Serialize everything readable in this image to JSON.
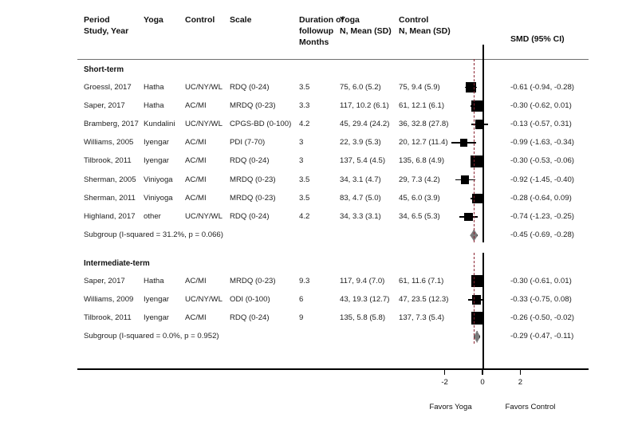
{
  "header": {
    "col_period": "Period\nStudy, Year",
    "col_yoga": "Yoga",
    "col_control": "Control",
    "col_scale": "Scale",
    "col_duration": "Duration of\nfollowup\nMonths",
    "col_yoga_n": "Yoga\nN, Mean (SD)",
    "col_control_n": "Control\nN, Mean (SD)",
    "col_smd": "SMD (95% CI)"
  },
  "axis": {
    "ticks": [
      "-2",
      "0",
      "2"
    ],
    "tick_values": [
      -2,
      0,
      2
    ],
    "favors_left": "Favors Yoga",
    "favors_right": "Favors Control",
    "null_value": 0
  },
  "colors": {
    "marker": "#000000",
    "diamond_fill": "#7b7b7b",
    "diamond_edge": "#2a2a2a",
    "prediction_line": "#8b2230",
    "rule": "#6f6f6f"
  },
  "chart_data": {
    "type": "forest",
    "title": "",
    "xlabel": "SMD (95% CI)",
    "xlim": [
      -2.6,
      2.8
    ],
    "null_line": 0,
    "groups": [
      {
        "label": "Short-term",
        "studies": [
          {
            "study": "Groessl, 2017",
            "yoga": "Hatha",
            "control": "UC/NY/WL",
            "scale": "RDQ (0-24)",
            "duration": "3.5",
            "yoga_n": "75, 6.0 (5.2)",
            "control_n": "75, 9.4 (5.9)",
            "smd_text": "-0.61 (-0.94, -0.28)",
            "smd": -0.61,
            "ci_low": -0.94,
            "ci_high": -0.28,
            "weight": 10.6
          },
          {
            "study": "Saper, 2017",
            "yoga": "Hatha",
            "control": "AC/MI",
            "scale": "MRDQ (0-23)",
            "duration": "3.3",
            "yoga_n": "117, 10.2 (6.1)",
            "control_n": "61, 12.1 (6.1)",
            "smd_text": "-0.30 (-0.62, 0.01)",
            "smd": -0.3,
            "ci_low": -0.62,
            "ci_high": 0.01,
            "weight": 11.5
          },
          {
            "study": "Bramberg, 2017",
            "yoga": "Kundalini",
            "control": "UC/NY/WL",
            "scale": "CPGS-BD (0-100)",
            "duration": "4.2",
            "yoga_n": "45, 29.4 (24.2)",
            "control_n": "36, 32.8 (27.8)",
            "smd_text": "-0.13 (-0.57, 0.31)",
            "smd": -0.13,
            "ci_low": -0.57,
            "ci_high": 0.31,
            "weight": 8.2
          },
          {
            "study": "Williams, 2005",
            "yoga": "Iyengar",
            "control": "AC/MI",
            "scale": "PDI (7-70)",
            "duration": "3",
            "yoga_n": "22, 3.9 (5.3)",
            "control_n": "20, 12.7 (11.4)",
            "smd_text": "-0.99 (-1.63, -0.34)",
            "smd": -0.99,
            "ci_low": -1.63,
            "ci_high": -0.34,
            "weight": 6.0
          },
          {
            "study": "Tilbrook, 2011",
            "yoga": "Iyengar",
            "control": "AC/MI",
            "scale": "RDQ (0-24)",
            "duration": "3",
            "yoga_n": "137, 5.4 (4.5)",
            "control_n": "135, 6.8 (4.9)",
            "smd_text": "-0.30 (-0.53, -0.06)",
            "smd": -0.3,
            "ci_low": -0.53,
            "ci_high": -0.06,
            "weight": 14.0
          },
          {
            "study": "Sherman, 2005",
            "yoga": "Viniyoga",
            "control": "AC/MI",
            "scale": "MRDQ (0-23)",
            "duration": "3.5",
            "yoga_n": "34, 3.1 (4.7)",
            "control_n": "29, 7.3 (4.2)",
            "smd_text": "-0.92 (-1.45, -0.40)",
            "smd": -0.92,
            "ci_low": -1.45,
            "ci_high": -0.4,
            "weight": 7.2
          },
          {
            "study": "Sherman, 2011",
            "yoga": "Viniyoga",
            "control": "AC/MI",
            "scale": "MRDQ (0-23)",
            "duration": "3.5",
            "yoga_n": "83, 4.7 (5.0)",
            "control_n": "45, 6.0 (3.9)",
            "smd_text": "-0.28 (-0.64, 0.09)",
            "smd": -0.28,
            "ci_low": -0.64,
            "ci_high": 0.09,
            "weight": 10.2
          },
          {
            "study": "Highland, 2017",
            "yoga": "other",
            "control": "UC/NY/WL",
            "scale": "RDQ (0-24)",
            "duration": "4.2",
            "yoga_n": "34, 3.3 (3.1)",
            "control_n": "34, 6.5 (5.3)",
            "smd_text": "-0.74 (-1.23, -0.25)",
            "smd": -0.74,
            "ci_low": -1.23,
            "ci_high": -0.25,
            "weight": 7.6
          }
        ],
        "summary": {
          "label": "Subgroup (I-squared = 31.2%, p = 0.066)",
          "smd_text": "-0.45 (-0.69, -0.28)",
          "smd": -0.45,
          "ci_low": -0.69,
          "ci_high": -0.28
        }
      },
      {
        "label": "Intermediate-term",
        "studies": [
          {
            "study": "Saper, 2017",
            "yoga": "Hatha",
            "control": "AC/MI",
            "scale": "MRDQ (0-23)",
            "duration": "9.3",
            "yoga_n": "117, 9.4 (7.0)",
            "control_n": "61, 11.6 (7.1)",
            "smd_text": "-0.30 (-0.61, 0.01)",
            "smd": -0.3,
            "ci_low": -0.61,
            "ci_high": 0.01,
            "weight": 13.0
          },
          {
            "study": "Williams, 2009",
            "yoga": "Iyengar",
            "control": "UC/NY/WL",
            "scale": "ODI (0-100)",
            "duration": "6",
            "yoga_n": "43, 19.3 (12.7)",
            "control_n": "47, 23.5 (12.3)",
            "smd_text": "-0.33 (-0.75, 0.08)",
            "smd": -0.33,
            "ci_low": -0.75,
            "ci_high": 0.08,
            "weight": 8.4
          },
          {
            "study": "Tilbrook, 2011",
            "yoga": "Iyengar",
            "control": "AC/MI",
            "scale": "RDQ (0-24)",
            "duration": "9",
            "yoga_n": "135, 5.8 (5.8)",
            "control_n": "137, 7.3 (5.4)",
            "smd_text": "-0.26 (-0.50, -0.02)",
            "smd": -0.26,
            "ci_low": -0.5,
            "ci_high": -0.02,
            "weight": 15.5
          }
        ],
        "summary": {
          "label": "Subgroup (I-squared = 0.0%, p = 0.952)",
          "smd_text": "-0.29 (-0.47, -0.11)",
          "smd": -0.29,
          "ci_low": -0.47,
          "ci_high": -0.11
        }
      }
    ]
  }
}
